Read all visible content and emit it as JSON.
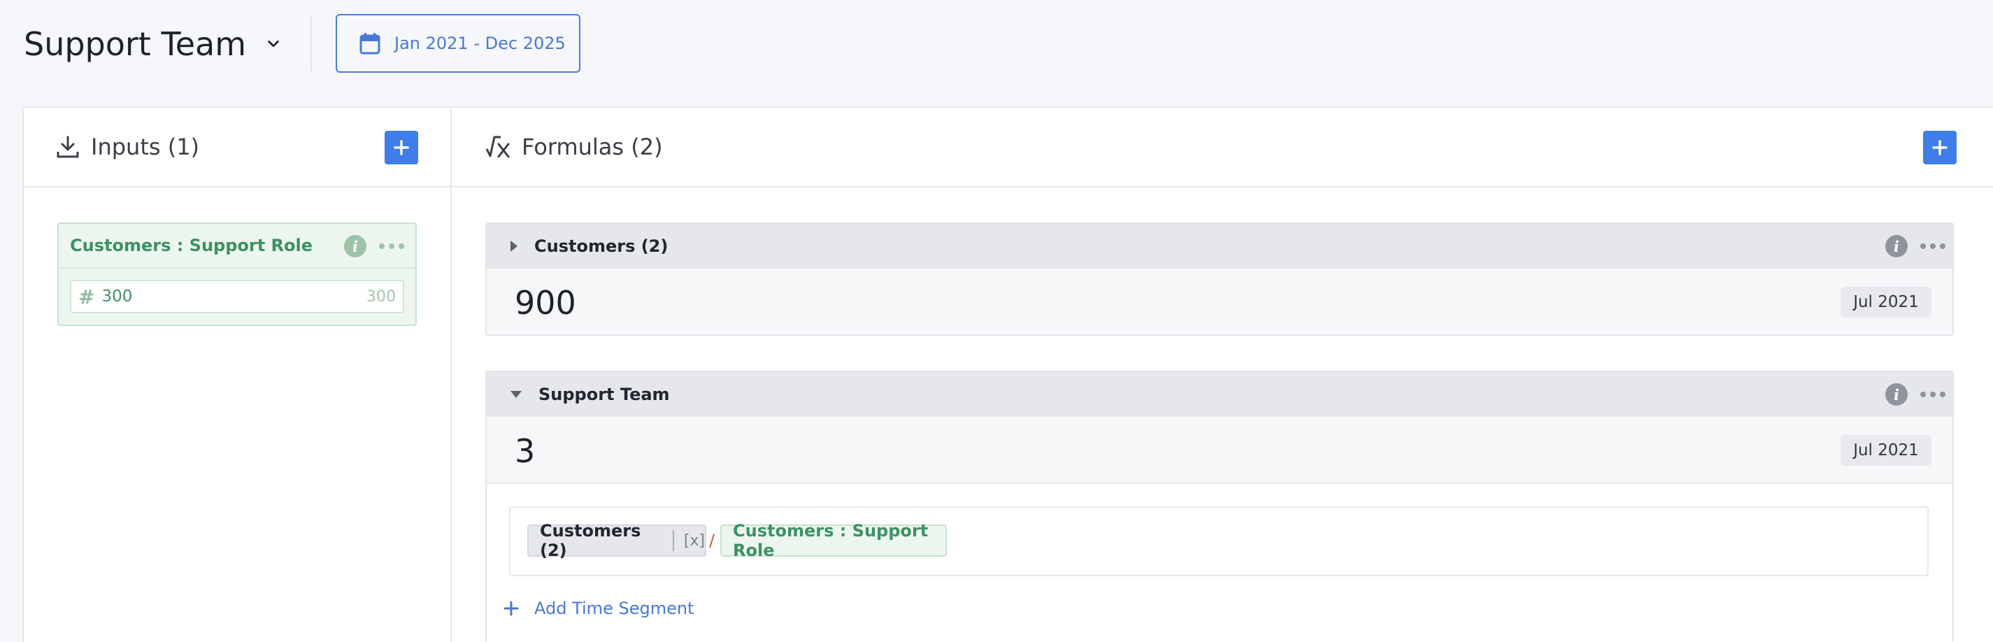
{
  "header": {
    "team_title": "Support Team",
    "date_range": "Jan 2021 - Dec 2025"
  },
  "inputs": {
    "title": "Inputs (1)",
    "items": [
      {
        "name": "Customers : Support Role",
        "value": "300",
        "hint": "300"
      }
    ]
  },
  "formulas": {
    "title": "Formulas (2)",
    "items": [
      {
        "name": "Customers (2)",
        "value": "900",
        "date": "Jul 2021",
        "expanded": false
      },
      {
        "name": "Support Team",
        "value": "3",
        "date": "Jul 2021",
        "expanded": true,
        "expression": {
          "ref_label": "Customers (2)",
          "ref_suffix": "[x]",
          "operator": "/",
          "input_label": "Customers : Support Role"
        },
        "add_segment_label": "Add Time Segment"
      }
    ]
  },
  "colors": {
    "accent": "#3f7de8",
    "input_green": "#3d9163",
    "operator_red": "#d2553f"
  }
}
